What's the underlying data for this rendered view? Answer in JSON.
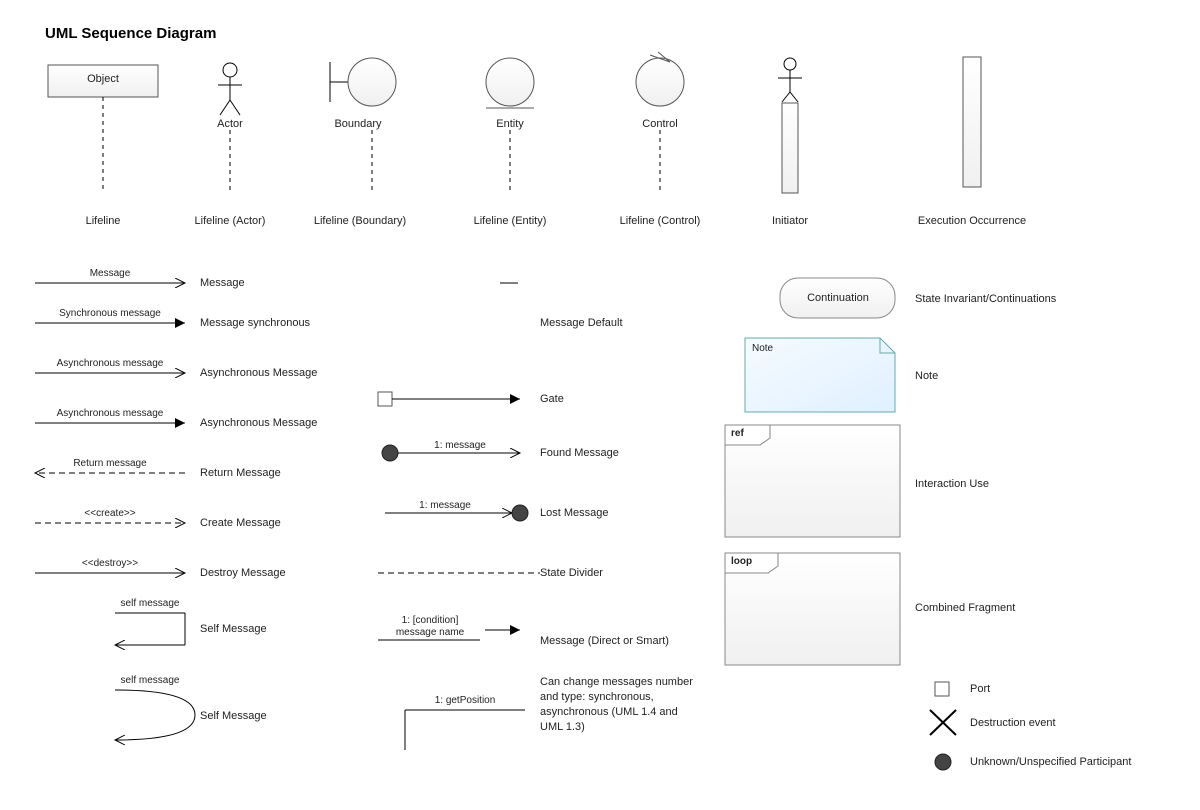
{
  "title": "UML Sequence Diagram",
  "row1": {
    "object": "Object",
    "lifeline": "Lifeline",
    "actor": "Actor",
    "lifeline_actor": "Lifeline (Actor)",
    "boundary": "Boundary",
    "lifeline_boundary": "Lifeline (Boundary)",
    "entity": "Entity",
    "lifeline_entity": "Lifeline (Entity)",
    "control": "Control",
    "lifeline_control": "Lifeline (Control)",
    "initiator": "Initiator",
    "exec": "Execution Occurrence"
  },
  "messages": {
    "message_text": "Message",
    "message_label": "Message",
    "sync_text": "Synchronous message",
    "sync_label": "Message synchronous",
    "async_text": "Asynchronous message",
    "async_label": "Asynchronous Message",
    "async2_text": "Asynchronous message",
    "async2_label": "Asynchronous Message",
    "return_text": "Return message",
    "return_label": "Return Message",
    "create_text": "<<create>>",
    "create_label": "Create Message",
    "destroy_text": "<<destroy>>",
    "destroy_label": "Destroy Message",
    "self_text": "self message",
    "self_label": "Self Message",
    "self2_text": "self message",
    "self2_label": "Self Message"
  },
  "middle": {
    "default": "Message Default",
    "gate": "Gate",
    "found_text": "1: message",
    "found_label": "Found Message",
    "lost_text": "1: message",
    "lost_label": "Lost Message",
    "divider": "State Divider",
    "direct_text1": "1: [condition]",
    "direct_text2": "message name",
    "direct_label": "Message (Direct or Smart)",
    "getpos_text": "1: getPosition",
    "getpos_label": "Can change messages number and type: synchronous, asynchronous (UML 1.4 and UML 1.3)"
  },
  "right": {
    "continuation": "Continuation",
    "continuation_label": "State Invariant/Continuations",
    "note": "Note",
    "note_label": "Note",
    "ref": "ref",
    "ref_label": "Interaction Use",
    "loop": "loop",
    "loop_label": "Combined Fragment",
    "port": "Port",
    "destruction": "Destruction event",
    "unknown": "Unknown/Unspecified Participant"
  }
}
